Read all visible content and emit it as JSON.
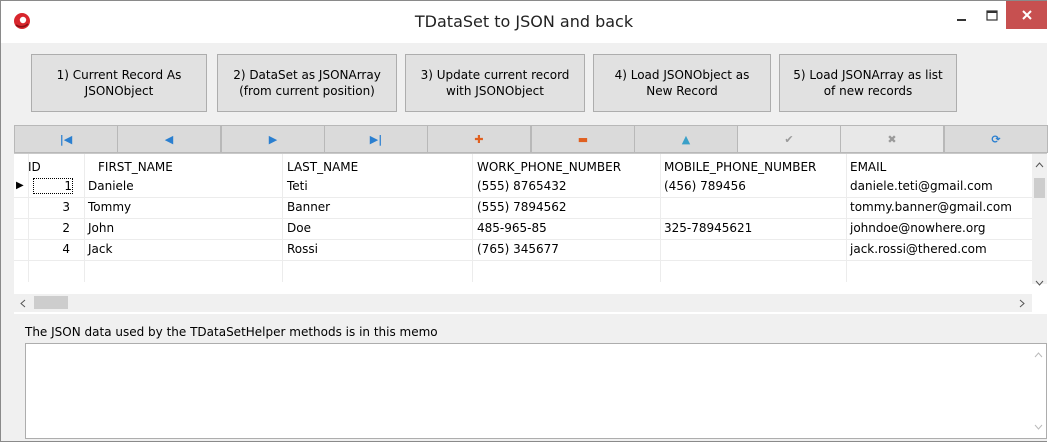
{
  "window": {
    "title": "TDataSet to JSON and back",
    "icon": "delphi-app-icon",
    "close_color": "#c75050"
  },
  "actions": [
    {
      "label": "1) Current Record As\nJSONObject"
    },
    {
      "label": "2) DataSet as JSONArray\n(from current position)"
    },
    {
      "label": "3) Update current record\nwith JSONObject"
    },
    {
      "label": "4) Load JSONObject as\nNew Record"
    },
    {
      "label": "5) Load JSONArray as list\nof new records"
    }
  ],
  "navigator": [
    {
      "icon": "first-record-icon",
      "glyph": "|◀",
      "color": "#2a7fd0"
    },
    {
      "icon": "prior-record-icon",
      "glyph": "◀",
      "color": "#2a7fd0"
    },
    {
      "icon": "next-record-icon",
      "glyph": "▶",
      "color": "#2a7fd0"
    },
    {
      "icon": "last-record-icon",
      "glyph": "▶|",
      "color": "#2a7fd0"
    },
    {
      "icon": "insert-record-icon",
      "glyph": "✚",
      "color": "#e06020"
    },
    {
      "icon": "delete-record-icon",
      "glyph": "▬",
      "color": "#e06020"
    },
    {
      "icon": "edit-record-icon",
      "glyph": "▲",
      "color": "#3aa0c8"
    },
    {
      "icon": "post-record-icon",
      "glyph": "✔",
      "color": "#9a9a9a"
    },
    {
      "icon": "cancel-record-icon",
      "glyph": "✖",
      "color": "#9a9a9a"
    },
    {
      "icon": "refresh-icon",
      "glyph": "⟳",
      "color": "#2a7fd0"
    }
  ],
  "grid": {
    "columns": [
      "ID",
      "FIRST_NAME",
      "LAST_NAME",
      "WORK_PHONE_NUMBER",
      "MOBILE_PHONE_NUMBER",
      "EMAIL"
    ],
    "rows": [
      {
        "id": "1",
        "first": "Daniele",
        "last": "Teti",
        "work": "(555) 8765432",
        "mobile": "(456) 789456",
        "email": "daniele.teti@gmail.com",
        "current": true
      },
      {
        "id": "3",
        "first": "Tommy",
        "last": "Banner",
        "work": "(555) 7894562",
        "mobile": "",
        "email": "tommy.banner@gmail.com",
        "current": false
      },
      {
        "id": "2",
        "first": "John",
        "last": "Doe",
        "work": "485-965-85",
        "mobile": "325-78945621",
        "email": "johndoe@nowhere.org",
        "current": false
      },
      {
        "id": "4",
        "first": "Jack",
        "last": "Rossi",
        "work": "(765) 345677",
        "mobile": "",
        "email": "jack.rossi@thered.com",
        "current": false
      }
    ]
  },
  "memo": {
    "label": "The JSON data used by the TDataSetHelper methods is in this memo",
    "value": ""
  }
}
